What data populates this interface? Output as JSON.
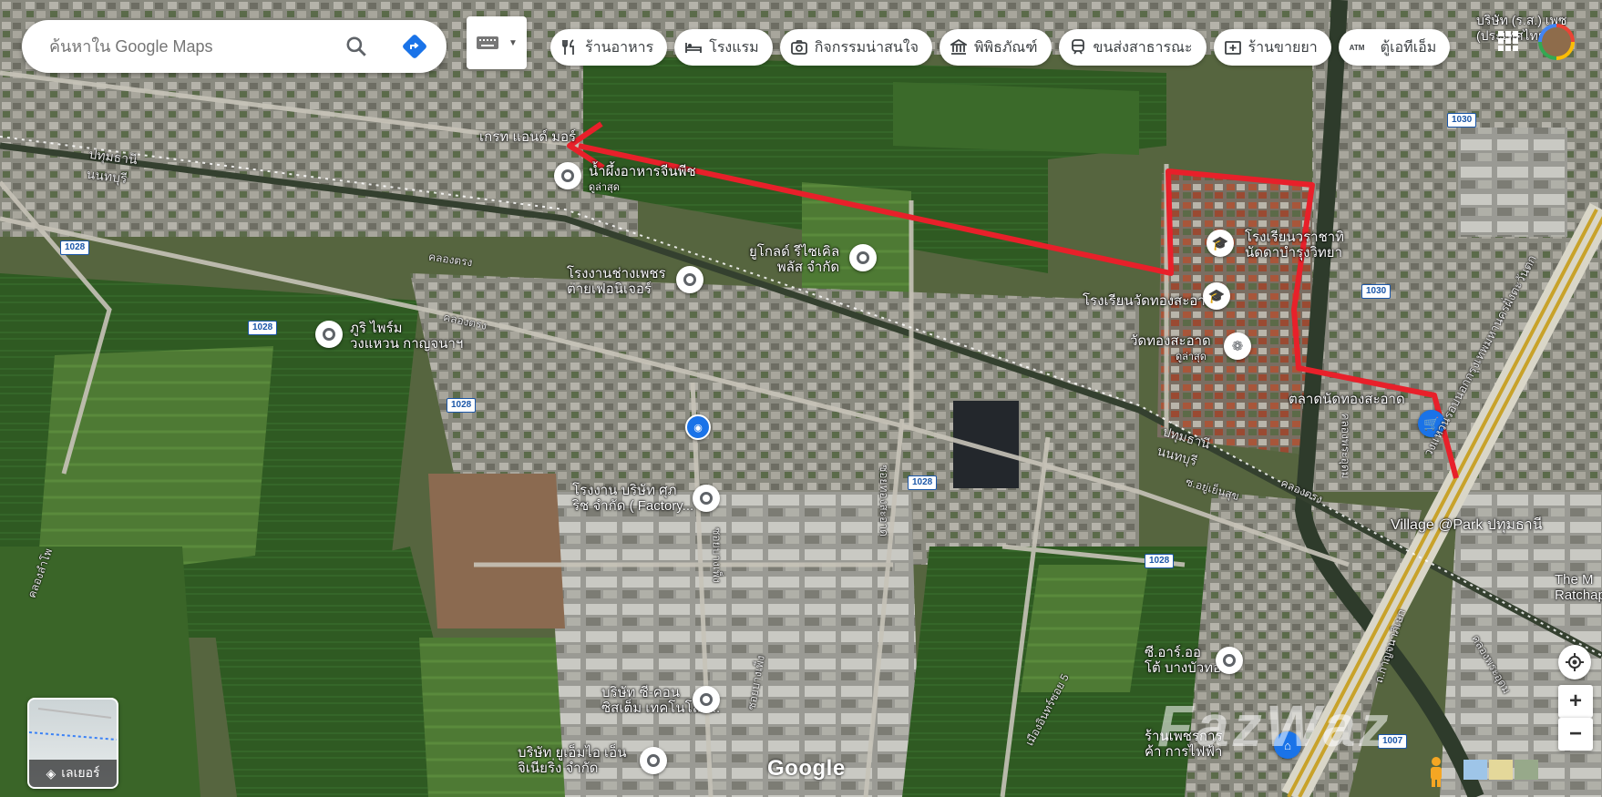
{
  "search": {
    "placeholder": "ค้นหาใน Google Maps"
  },
  "chips": [
    {
      "label": "ร้านอาหาร",
      "icon": "fork-knife-icon"
    },
    {
      "label": "โรงแรม",
      "icon": "bed-icon"
    },
    {
      "label": "กิจกรรมน่าสนใจ",
      "icon": "camera-icon"
    },
    {
      "label": "พิพิธภัณฑ์",
      "icon": "museum-icon"
    },
    {
      "label": "ขนส่งสาธารณะ",
      "icon": "train-icon"
    },
    {
      "label": "ร้านขายยา",
      "icon": "pharmacy-icon"
    },
    {
      "label": "ตู้เอทีเอ็ม",
      "icon": "atm-icon"
    }
  ],
  "atm_tag": "ATM",
  "top_right_label": "บริษัท (ร.ส.) เพซ\n(ประเทศไทย)",
  "places": {
    "grade_and_more": "เกรท แอนด์ มอร์",
    "nampueng": "น้ำผึ้งอาหารจีนพีช",
    "latest": "ดูล่าสุด",
    "ugold": "ยูโกลด์ รีไซเคิล\nพลัส จำกัด",
    "rongngan_changpet": "โรงงานช่างเพชร\nต่ายเฟอนิเจอร์",
    "school_rajathip": "โรงเรียนวราชาทิ\nนัดดาบำรุงวิทยา",
    "school_wat": "โรงเรียนวัดทองสะอาด",
    "wat": "วัดทองสะอาด",
    "wat_latest": "ดูล่าสุด",
    "phuri": "ภูริ ไพร์ม\nวงแหวน กาญจนาฯ",
    "market": "ตลาดนัดทองสะอาด",
    "factory": "โรงงาน บริษัท ศุภ\nริช จำกัด ( Factory...",
    "village": "Village @Park ปทุมธานี",
    "the_m": "The M\nRatchapl",
    "cr_auto": "ซี.อาร์.ออ\nโต้ บางบัวทอง",
    "ccon": "บริษัท ซี-คอน\nซิสเต็ม เทคโนโลยี...",
    "ym": "บริษัท ยูเอ็มไอ เอ็น\nจิเนียริ่ง จำกัด",
    "petch": "ร้านเพชรการ\nค้า การไฟฟ้า"
  },
  "roads": {
    "khlong_trong_1": "คลองตรง",
    "khlong_trong_2": "คลองตรง",
    "khlong_trong_3": "คลองตรง",
    "pathum_nonthaburi_1": "ปทุมธานี\nนนทบุรี",
    "pathum_nonthaburi_2": "ปทุมธานี\nนนทบุรี",
    "khlong_phra_udom_1": "คลองพระอุดม",
    "khlong_phra_udom_2": "คลองพระอุดม",
    "ring_road": "วงแหวนรอบนอกกรุงเทพมหานครฝั่งตะวันตก",
    "soi_yuyenkhun": "ซ.อยู่เย็นสุข",
    "soi_thongsaard": "ซอยทองสะอาด",
    "soi_bangpheng": "ซอยบางเพ็ง",
    "soi_bangpheng2": "ซอยบางเพ็ง",
    "soi_kanchana": "ถ.กาญจนาภิเษก",
    "soi_mueang": "เมืองอินทร์ซอย 5",
    "lat_phrao": "คลองลำโพ"
  },
  "road_shields": [
    "1028",
    "1028",
    "1028",
    "1028",
    "1028",
    "1030",
    "1030",
    "1007"
  ],
  "layers_label": "เลเยอร์",
  "google_label": "Google",
  "watermark": "FazWaz",
  "colors": {
    "route": "#e8202a",
    "pin_gray": "#5f6368",
    "shield_blue": "#1a56a8",
    "market_blue": "#1a73e8",
    "school_gray": "#5f6368"
  },
  "route_description": "ตำแหน่งเส้นทางสีแดง"
}
